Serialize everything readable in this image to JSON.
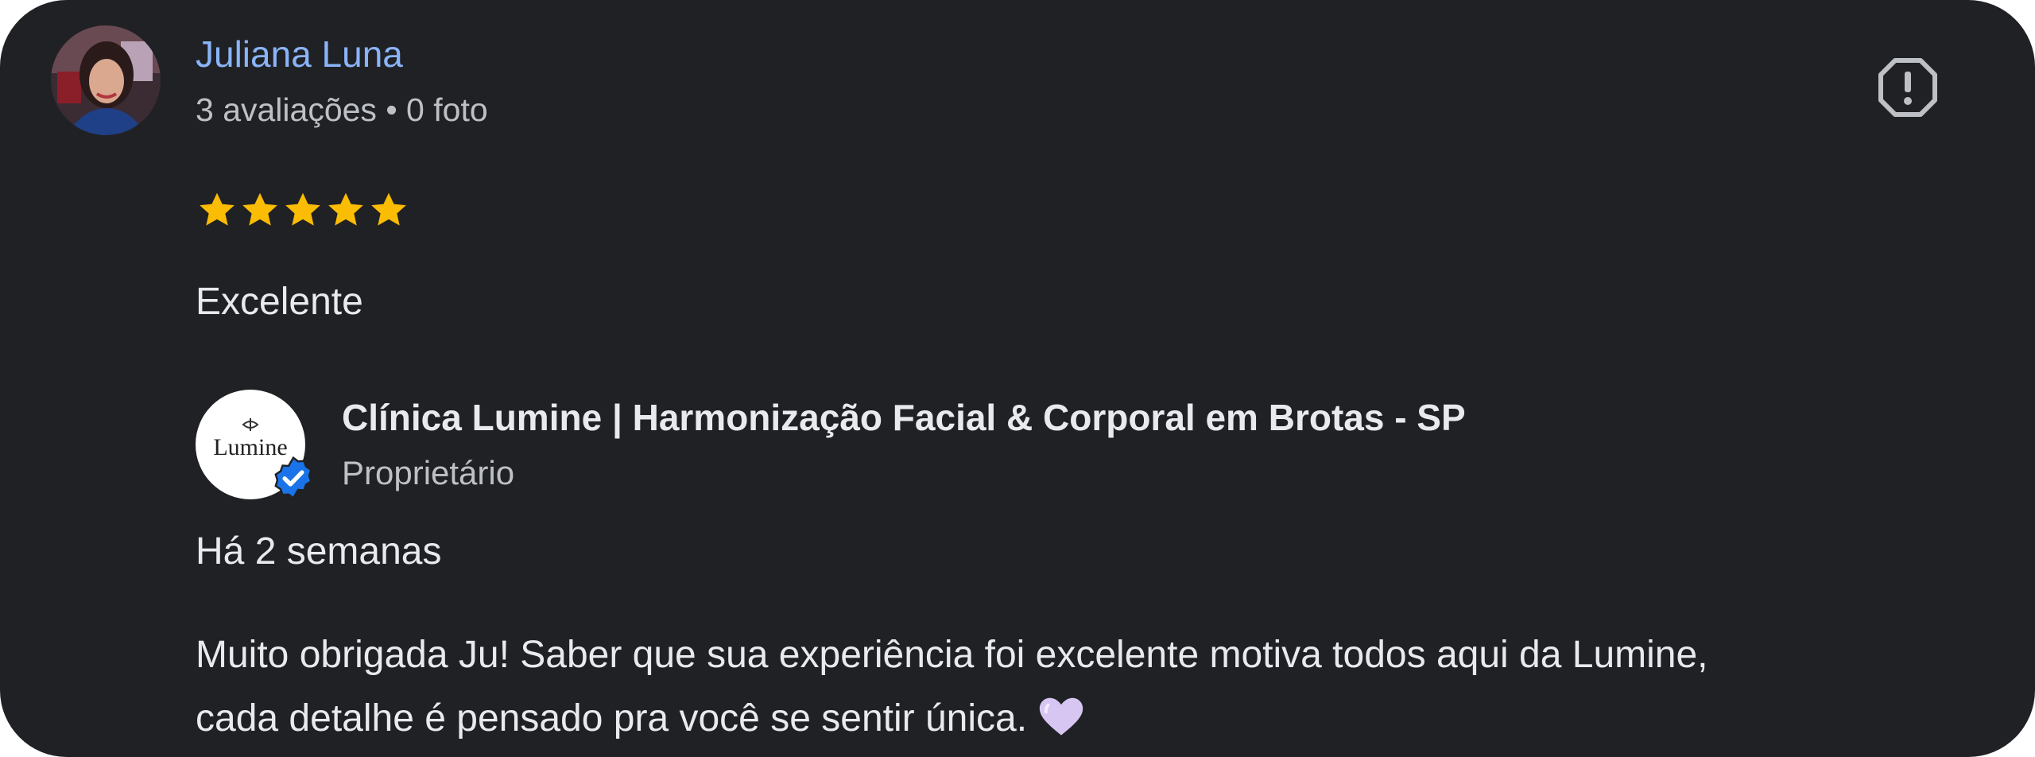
{
  "review": {
    "reviewer": {
      "name": "Juliana Luna",
      "meta": "3 avaliações • 0 foto",
      "avatar_icon": "profile-photo"
    },
    "report_icon": "report-flag-octagon-icon",
    "rating": 5,
    "rating_max": 5,
    "star_color": "#fbbc04",
    "text": "Excelente"
  },
  "owner_reply": {
    "owner_name": "Clínica Lumine | Harmonização Facial & Corporal em Brotas - SP",
    "owner_role": "Proprietário",
    "logo_text": "Lumine",
    "verified_icon": "verified-check-badge-icon",
    "verified_color": "#1a73e8",
    "date": "Há 2 semanas",
    "text_line_1": "Muito obrigada Ju! Saber que sua experiência foi excelente motiva todos aqui da Lumine,",
    "text_line_2": "cada detalhe é pensado pra você se sentir única.",
    "heart_icon": "light-purple-heart-emoji"
  },
  "colors": {
    "background": "#202124",
    "name_link": "#8ab4f8",
    "text_primary": "#e8eaed",
    "text_secondary": "#bdc1c6"
  }
}
